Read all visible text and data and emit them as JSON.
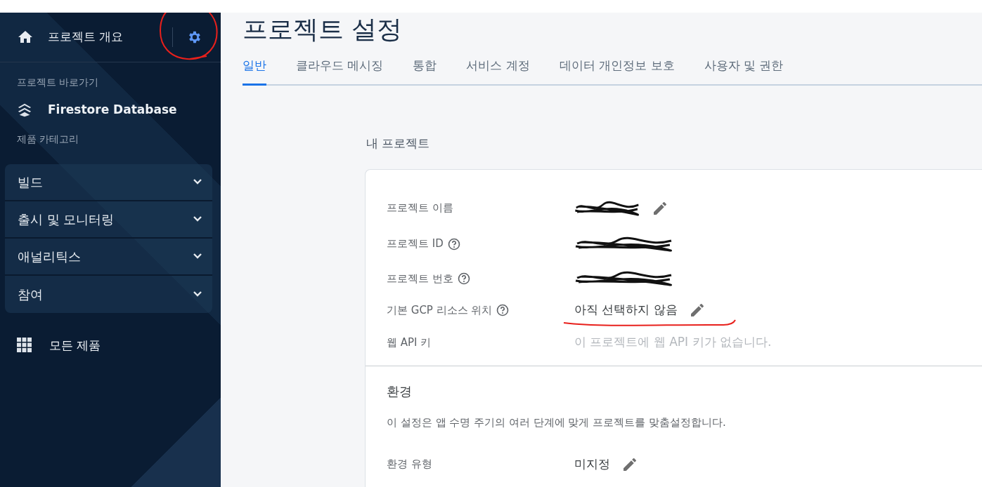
{
  "sidebar": {
    "overview": {
      "label": "프로젝트 개요"
    },
    "settings_button": {
      "circled": true
    },
    "shortcuts_label": "프로젝트 바로가기",
    "shortcuts": [
      {
        "label": "Firestore Database"
      }
    ],
    "categories_label": "제품 카테고리",
    "categories": [
      {
        "label": "빌드",
        "expanded": false
      },
      {
        "label": "출시 및 모니터링",
        "expanded": false
      },
      {
        "label": "애널리틱스",
        "expanded": false
      },
      {
        "label": "참여",
        "expanded": false
      }
    ],
    "all_products": {
      "label": "모든 제품"
    }
  },
  "page_title": "프로젝트 설정",
  "tabs": [
    {
      "label": "일반",
      "selected": true
    },
    {
      "label": "클라우드 메시징",
      "selected": false
    },
    {
      "label": "통합",
      "selected": false
    },
    {
      "label": "서비스 계정",
      "selected": false
    },
    {
      "label": "데이터 개인정보 보호",
      "selected": false
    },
    {
      "label": "사용자 및 권한",
      "selected": false
    }
  ],
  "section_title": "내 프로젝트",
  "project_fields": [
    {
      "label": "프로젝트 이름",
      "kind": "redacted",
      "help": false,
      "editable": true,
      "underlined": false
    },
    {
      "label": "프로젝트 ID",
      "kind": "redacted",
      "help": true,
      "editable": false,
      "underlined": false
    },
    {
      "label": "프로젝트 번호",
      "kind": "redacted",
      "help": true,
      "editable": false,
      "underlined": false
    },
    {
      "label": "기본 GCP 리소스 위치",
      "kind": "text",
      "value": "아직 선택하지 않음",
      "help": true,
      "editable": true,
      "underlined": true
    },
    {
      "label": "웹 API 키",
      "kind": "empty",
      "value": "이 프로젝트에 웹 API 키가 없습니다.",
      "help": false,
      "editable": false,
      "underlined": false
    }
  ],
  "environment": {
    "title": "환경",
    "description": "이 설정은 앱 수명 주기의 여러 단계에 맞게 프로젝트를 맞춤설정합니다.",
    "fields": [
      {
        "label": "환경 유형",
        "kind": "text",
        "value": "미지정",
        "help": false,
        "editable": true,
        "underlined": false
      }
    ]
  }
}
